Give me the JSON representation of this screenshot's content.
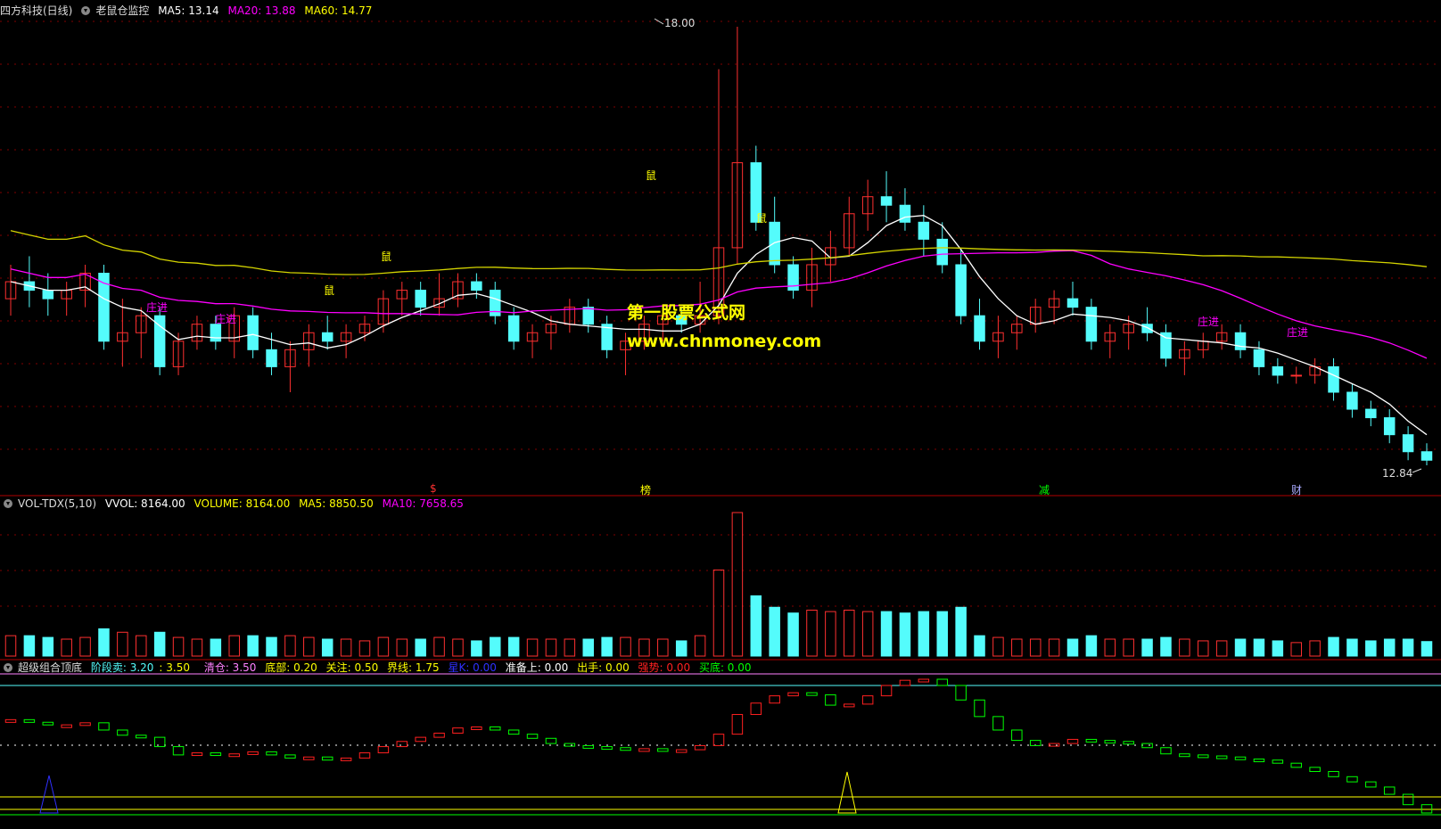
{
  "main_header": {
    "stock": "四方科技(日线)",
    "indicator": "老鼠仓监控",
    "ma5": "MA5: 13.14",
    "ma20": "MA20: 13.88",
    "ma60": "MA60: 14.77"
  },
  "vol_header": {
    "name": "VOL-TDX(5,10)",
    "vvol": "VVOL: 8164.00",
    "volume": "VOLUME: 8164.00",
    "ma5": "MA5: 8850.50",
    "ma10": "MA10: 7658.65"
  },
  "ind_header": {
    "name": "超级组合顶底",
    "stage_sell_a": "阶段卖: 3.20",
    "stage_sell_b": ": 3.50",
    "clear": "清仓: 3.50",
    "bottom": "底部: 0.20",
    "focus": "关注: 0.50",
    "boundary": "界线: 1.75",
    "star": "星K: 0.00",
    "ready": "准备上: 0.00",
    "act": "出手: 0.00",
    "strong": "强势: 0.00",
    "buy_bottom": "买底: 0.00"
  },
  "watermark": {
    "name": "第一股票公式网",
    "url": "www.chnmoney.com"
  },
  "price_labels": {
    "high": "18.00",
    "low": "12.84"
  },
  "markers": {
    "mouse": "鼠",
    "zhuangjin": "庄进",
    "bottom_bar": [
      "$",
      "榜",
      "减",
      "财"
    ]
  },
  "colors": {
    "up": "#ff3030",
    "down": "#54fcfc",
    "ma5": "#ffffff",
    "ma20": "#ff00ff",
    "ma60": "#d4d400",
    "grid": "#800000",
    "ind_up": "#ff2020",
    "ind_down": "#00ff00"
  },
  "chart_data": [
    {
      "type": "candlestick",
      "title": "老鼠仓监控",
      "series": [
        {
          "name": "MA5",
          "value": 13.14
        },
        {
          "name": "MA20",
          "value": 13.88
        },
        {
          "name": "MA60",
          "value": 14.77
        }
      ],
      "annotations": {
        "max_price": 18.0,
        "min_price": 12.84
      },
      "ohlc": [
        [
          14.8,
          15.2,
          14.6,
          15.0
        ],
        [
          15.0,
          15.3,
          14.7,
          14.9
        ],
        [
          14.9,
          15.1,
          14.6,
          14.8
        ],
        [
          14.8,
          15.0,
          14.6,
          14.9
        ],
        [
          14.9,
          15.2,
          14.7,
          15.1
        ],
        [
          15.1,
          15.2,
          14.2,
          14.3
        ],
        [
          14.3,
          14.8,
          14.0,
          14.4
        ],
        [
          14.4,
          14.7,
          14.1,
          14.6
        ],
        [
          14.6,
          14.7,
          13.9,
          14.0
        ],
        [
          14.0,
          14.4,
          13.9,
          14.3
        ],
        [
          14.3,
          14.6,
          14.2,
          14.5
        ],
        [
          14.5,
          14.6,
          14.2,
          14.3
        ],
        [
          14.3,
          14.7,
          14.1,
          14.6
        ],
        [
          14.6,
          14.7,
          14.1,
          14.2
        ],
        [
          14.2,
          14.4,
          13.9,
          14.0
        ],
        [
          14.0,
          14.3,
          13.7,
          14.2
        ],
        [
          14.2,
          14.5,
          14.0,
          14.4
        ],
        [
          14.4,
          14.6,
          14.2,
          14.3
        ],
        [
          14.3,
          14.5,
          14.1,
          14.4
        ],
        [
          14.4,
          14.6,
          14.3,
          14.5
        ],
        [
          14.5,
          14.9,
          14.4,
          14.8
        ],
        [
          14.8,
          15.0,
          14.6,
          14.9
        ],
        [
          14.9,
          15.0,
          14.6,
          14.7
        ],
        [
          14.7,
          15.1,
          14.6,
          14.8
        ],
        [
          14.8,
          15.1,
          14.7,
          15.0
        ],
        [
          15.0,
          15.1,
          14.8,
          14.9
        ],
        [
          14.9,
          15.0,
          14.5,
          14.6
        ],
        [
          14.6,
          14.7,
          14.2,
          14.3
        ],
        [
          14.3,
          14.5,
          14.1,
          14.4
        ],
        [
          14.4,
          14.6,
          14.2,
          14.5
        ],
        [
          14.5,
          14.8,
          14.4,
          14.7
        ],
        [
          14.7,
          14.8,
          14.4,
          14.5
        ],
        [
          14.5,
          14.6,
          14.1,
          14.2
        ],
        [
          14.2,
          14.4,
          13.9,
          14.3
        ],
        [
          14.3,
          14.6,
          14.2,
          14.5
        ],
        [
          14.5,
          14.7,
          14.3,
          14.6
        ],
        [
          14.6,
          14.7,
          14.4,
          14.5
        ],
        [
          14.5,
          15.0,
          14.4,
          14.6
        ],
        [
          14.6,
          17.5,
          14.5,
          15.4
        ],
        [
          15.4,
          18.0,
          15.2,
          16.4
        ],
        [
          16.4,
          16.6,
          15.6,
          15.7
        ],
        [
          15.7,
          16.0,
          15.1,
          15.2
        ],
        [
          15.2,
          15.3,
          14.8,
          14.9
        ],
        [
          14.9,
          15.4,
          14.7,
          15.2
        ],
        [
          15.2,
          15.6,
          15.0,
          15.4
        ],
        [
          15.4,
          16.0,
          15.3,
          15.8
        ],
        [
          15.8,
          16.2,
          15.6,
          16.0
        ],
        [
          16.0,
          16.3,
          15.7,
          15.9
        ],
        [
          15.9,
          16.1,
          15.6,
          15.7
        ],
        [
          15.7,
          15.9,
          15.3,
          15.5
        ],
        [
          15.5,
          15.7,
          15.1,
          15.2
        ],
        [
          15.2,
          15.4,
          14.5,
          14.6
        ],
        [
          14.6,
          14.8,
          14.2,
          14.3
        ],
        [
          14.3,
          14.6,
          14.1,
          14.4
        ],
        [
          14.4,
          14.6,
          14.2,
          14.5
        ],
        [
          14.5,
          14.8,
          14.4,
          14.7
        ],
        [
          14.7,
          14.9,
          14.5,
          14.8
        ],
        [
          14.8,
          15.0,
          14.6,
          14.7
        ],
        [
          14.7,
          14.8,
          14.2,
          14.3
        ],
        [
          14.3,
          14.5,
          14.1,
          14.4
        ],
        [
          14.4,
          14.6,
          14.2,
          14.5
        ],
        [
          14.5,
          14.7,
          14.3,
          14.4
        ],
        [
          14.4,
          14.5,
          14.0,
          14.1
        ],
        [
          14.1,
          14.3,
          13.9,
          14.2
        ],
        [
          14.2,
          14.4,
          14.1,
          14.3
        ],
        [
          14.3,
          14.5,
          14.2,
          14.4
        ],
        [
          14.4,
          14.5,
          14.1,
          14.2
        ],
        [
          14.2,
          14.3,
          13.9,
          14.0
        ],
        [
          14.0,
          14.1,
          13.8,
          13.9
        ],
        [
          13.9,
          14.0,
          13.8,
          13.9
        ],
        [
          13.9,
          14.1,
          13.8,
          14.0
        ],
        [
          14.0,
          14.1,
          13.6,
          13.7
        ],
        [
          13.7,
          13.8,
          13.4,
          13.5
        ],
        [
          13.5,
          13.6,
          13.3,
          13.4
        ],
        [
          13.4,
          13.5,
          13.1,
          13.2
        ],
        [
          13.2,
          13.3,
          12.9,
          13.0
        ],
        [
          13.0,
          13.1,
          12.84,
          12.9
        ]
      ]
    },
    {
      "type": "bar",
      "title": "VOL-TDX(5,10)",
      "series": [
        {
          "name": "VOLUME",
          "value": 8164.0
        },
        {
          "name": "MA5",
          "value": 8850.5
        },
        {
          "name": "MA10",
          "value": 7658.65
        }
      ]
    },
    {
      "type": "line",
      "title": "超级组合顶底",
      "series": [
        {
          "name": "阶段卖",
          "value": 3.2
        },
        {
          "name": "清仓",
          "value": 3.5
        },
        {
          "name": "底部",
          "value": 0.2
        },
        {
          "name": "关注",
          "value": 0.5
        },
        {
          "name": "界线",
          "value": 1.75
        }
      ]
    }
  ]
}
